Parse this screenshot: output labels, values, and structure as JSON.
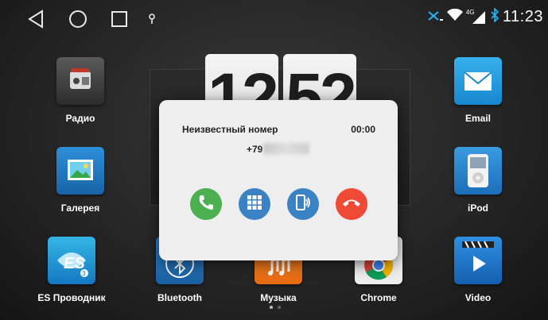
{
  "status_bar": {
    "time": "11:23",
    "network_type": "4G",
    "icons": [
      "back-icon",
      "home-icon",
      "recents-icon",
      "location-icon",
      "no-signal-icon",
      "wifi-icon",
      "cell-signal-icon",
      "bluetooth-icon"
    ]
  },
  "clock_widget": {
    "hours": "12",
    "minutes": "52"
  },
  "apps": {
    "radio": {
      "label": "Радио",
      "icon": "radio-icon"
    },
    "gallery": {
      "label": "Галерея",
      "icon": "gallery-icon"
    },
    "es_explorer": {
      "label": "ES Проводник",
      "icon": "es-explorer-icon"
    },
    "bluetooth": {
      "label": "Bluetooth",
      "icon": "bluetooth-app-icon"
    },
    "music": {
      "label": "Музыка",
      "icon": "music-icon"
    },
    "chrome": {
      "label": "Chrome",
      "icon": "chrome-icon"
    },
    "email": {
      "label": "Email",
      "icon": "email-icon"
    },
    "ipod": {
      "label": "iPod",
      "icon": "ipod-icon"
    },
    "video": {
      "label": "Video",
      "icon": "video-icon"
    }
  },
  "call_dialog": {
    "caller": "Неизвестный номер",
    "duration": "00:00",
    "number": "+79",
    "buttons": [
      {
        "icon": "answer-call-icon",
        "color": "#4caf50"
      },
      {
        "icon": "keypad-icon",
        "color": "#3b82c4"
      },
      {
        "icon": "phone-speaker-icon",
        "color": "#3b82c4"
      },
      {
        "icon": "end-call-icon",
        "color": "#ef4a36"
      }
    ]
  },
  "page_indicator": {
    "pages": 2,
    "current": 1
  },
  "colors": {
    "accent_blue": "#3b82c4",
    "answer_green": "#4caf50",
    "end_red": "#ef4a36",
    "status_blue": "#29b6f6"
  }
}
